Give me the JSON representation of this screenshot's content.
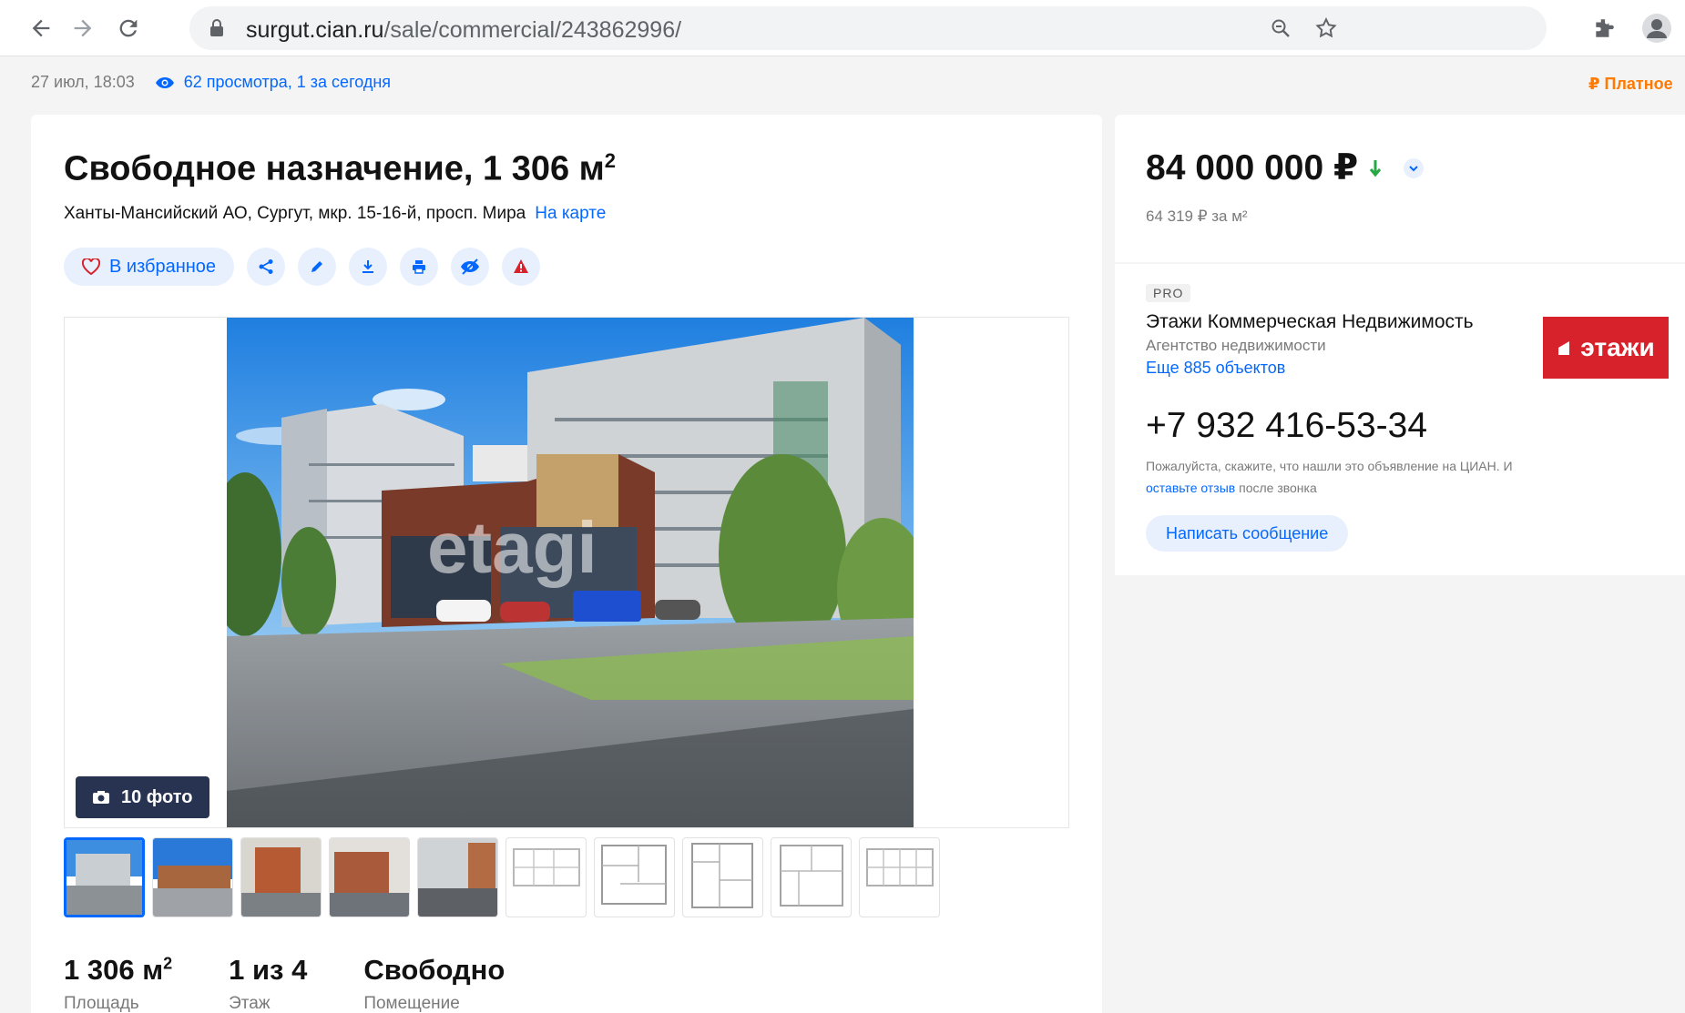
{
  "browser": {
    "url_domain": "surgut.cian.ru",
    "url_path": "/sale/commercial/243862996/"
  },
  "meta": {
    "date": "27 июл, 18:03",
    "views": "62 просмотра, 1 за сегодня",
    "paid_badge": "₽ Платное"
  },
  "listing": {
    "title": "Свободное назначение, 1 306 м",
    "title_sup": "2",
    "address": "Ханты-Мансийский АО, Сургут, мкр. 15-16-й, просп. Мира",
    "map_link": "На карте",
    "favorite_label": "В избранное",
    "photo_count": "10 фото",
    "watermark": "etagi",
    "facts": [
      {
        "value": "1 306 м",
        "sup": "2",
        "label": "Площадь"
      },
      {
        "value": "1 из 4",
        "sup": "",
        "label": "Этаж"
      },
      {
        "value": "Свободно",
        "sup": "",
        "label": "Помещение"
      }
    ]
  },
  "price": {
    "amount": "84 000 000 ₽",
    "per_m2": "64 319 ₽ за м²",
    "trend": "down"
  },
  "agent": {
    "badge": "PRO",
    "name": "Этажи Коммерческая Недвижимость",
    "type": "Агентство недвижимости",
    "more_link": "Еще 885 объектов",
    "logo_text": "этажи",
    "phone": "+7 932 416-53-34",
    "note_part1": "Пожалуйста, скажите, что нашли это объявление на ЦИАН. И ",
    "note_link": "оставьте отзыв",
    "note_part2": " после звонка",
    "message_button": "Написать сообщение"
  },
  "colors": {
    "accent": "#0468ff",
    "price_down": "#28a745",
    "logo_bg": "#d7222b",
    "paid": "#ff7a00"
  }
}
